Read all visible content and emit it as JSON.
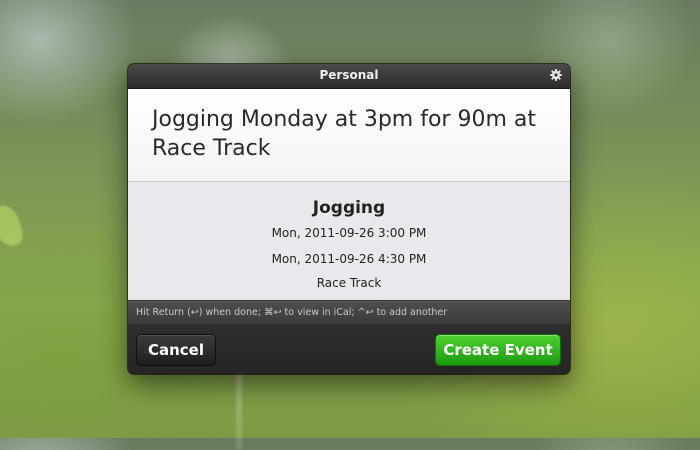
{
  "window": {
    "title": "Personal",
    "settings_icon": "gear-icon"
  },
  "input": {
    "text": "Jogging Monday at 3pm for 90m at Race Track"
  },
  "preview": {
    "title": "Jogging",
    "start": "Mon, 2011-09-26 3:00 PM",
    "end": "Mon, 2011-09-26 4:30 PM",
    "location": "Race Track"
  },
  "hint": {
    "text": "Hit Return (↩) when done; ⌘↩ to view in iCal; ^↩ to add another"
  },
  "buttons": {
    "cancel": "Cancel",
    "create": "Create Event"
  },
  "colors": {
    "accent": "#22a915"
  }
}
